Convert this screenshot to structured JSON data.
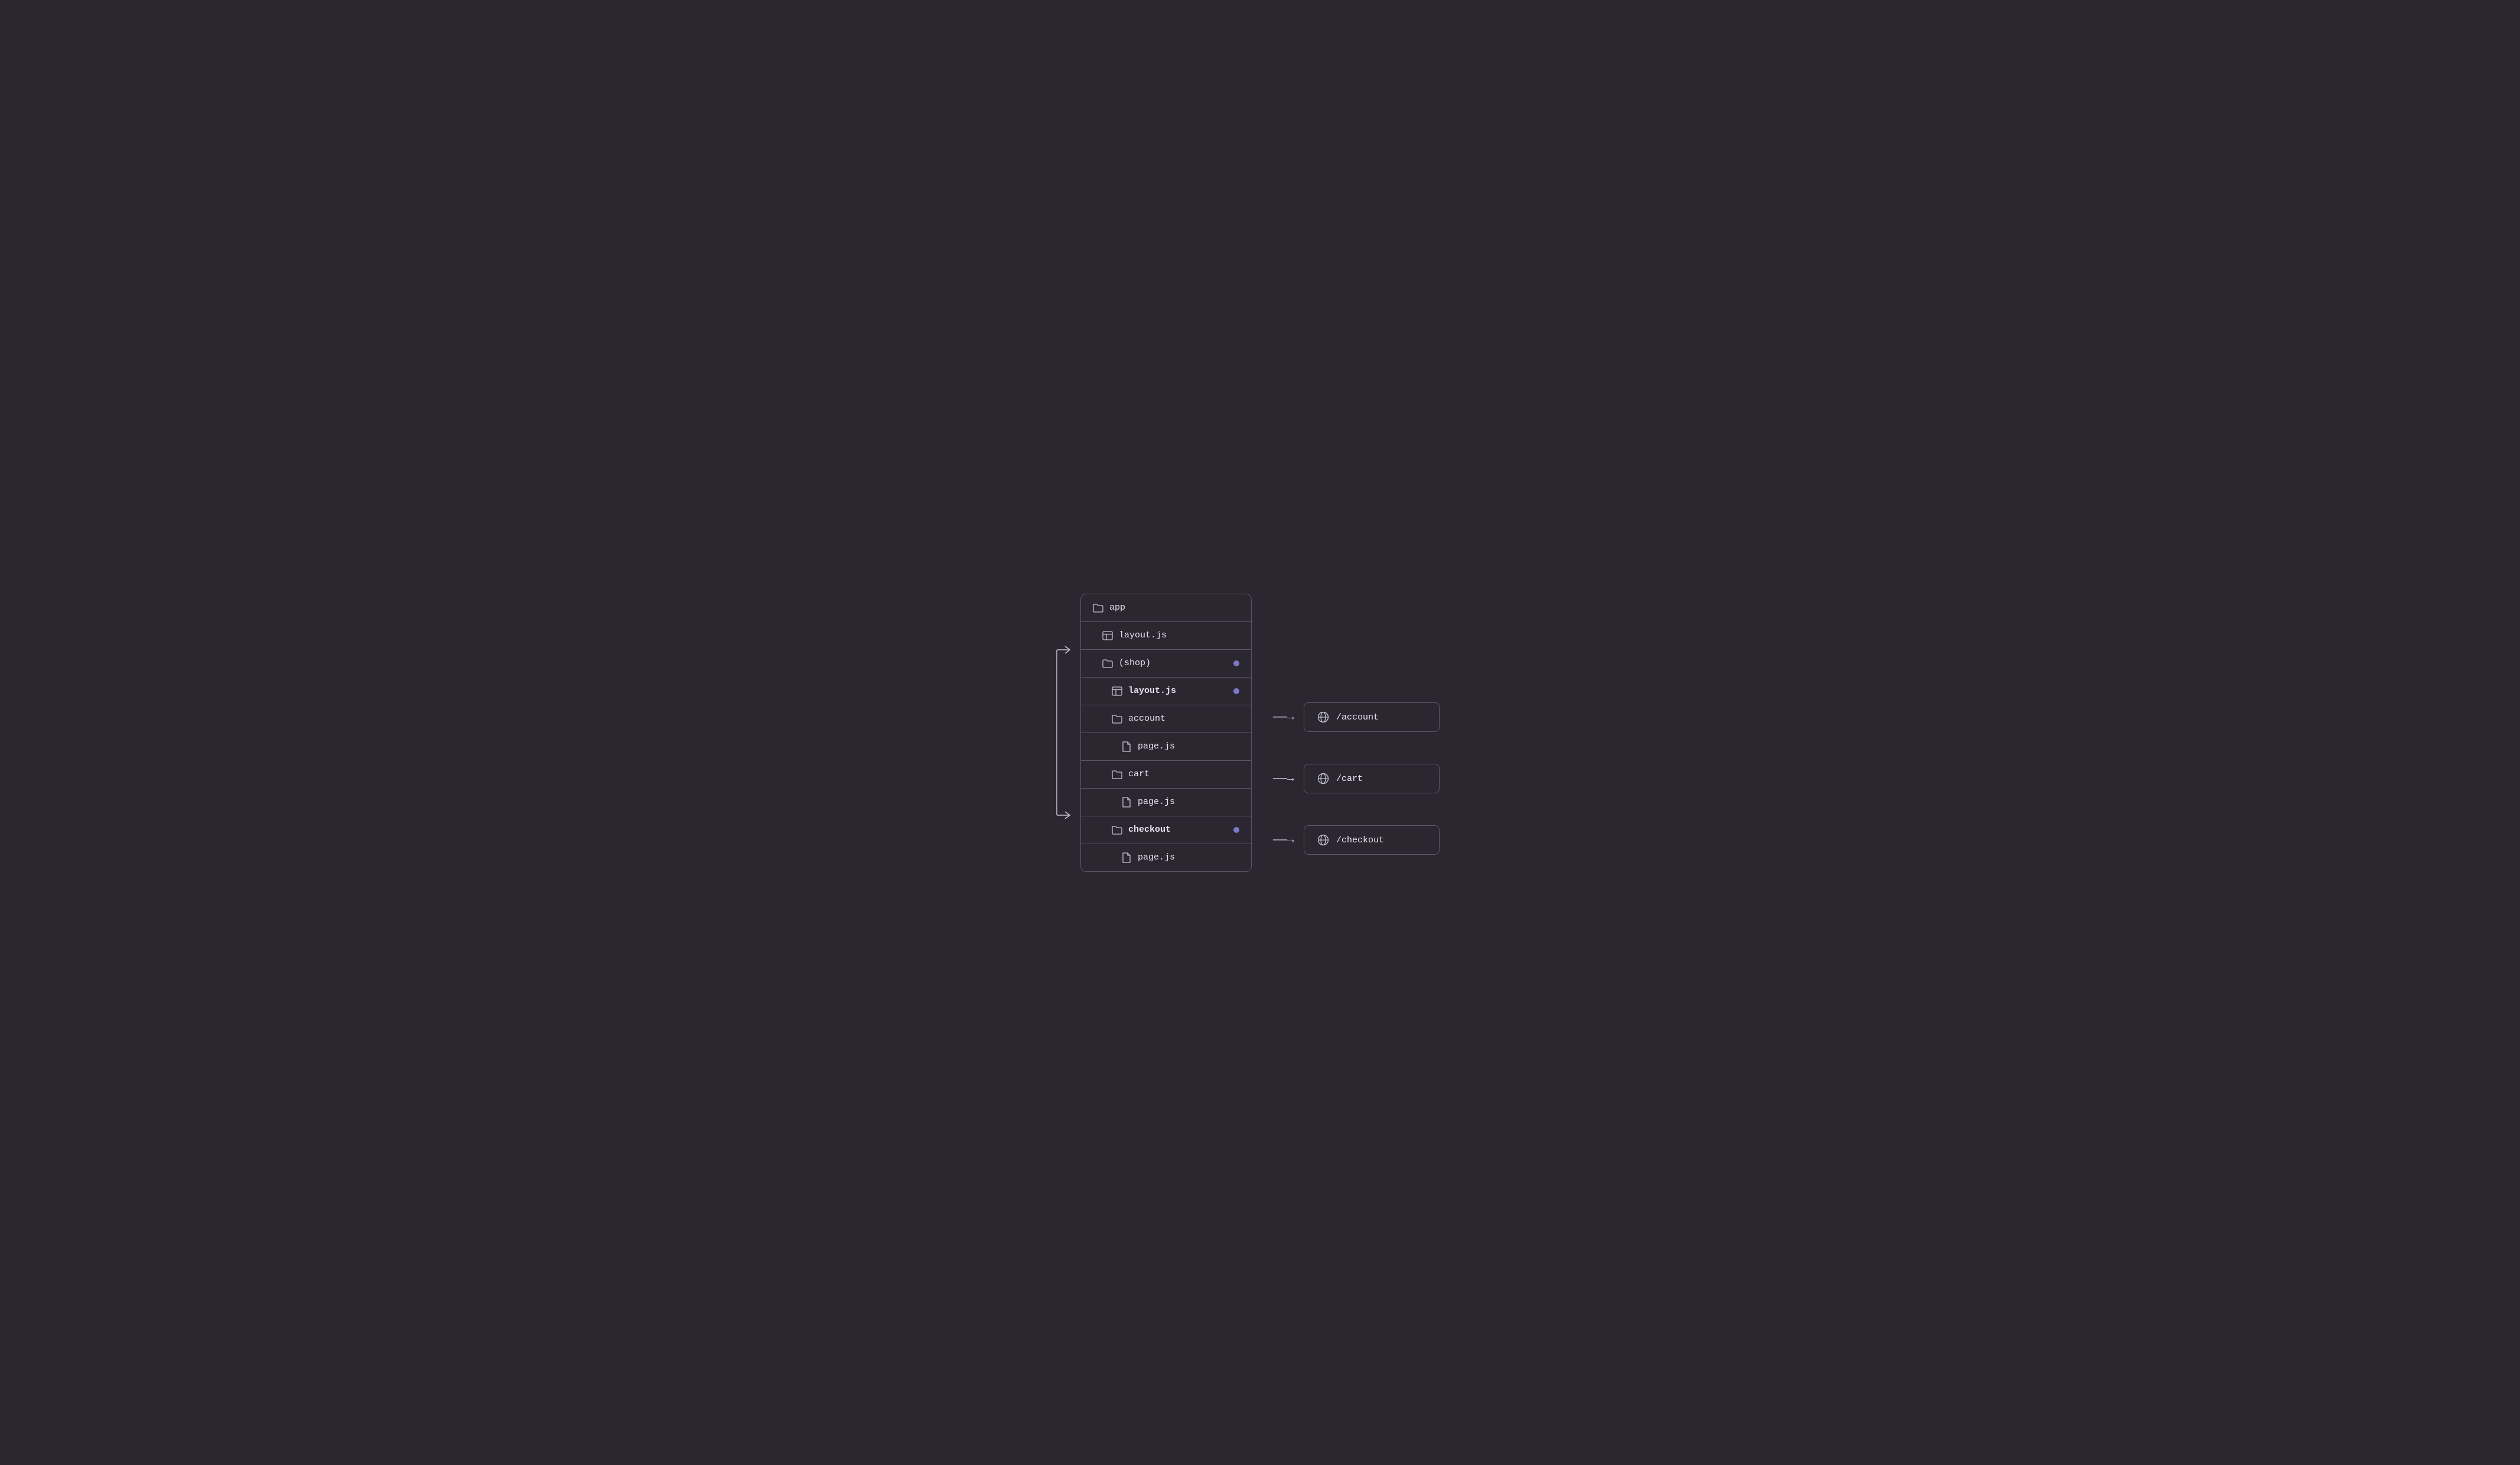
{
  "colors": {
    "bg": "#2a2730",
    "border": "#5a5567",
    "text": "#e8e4f0",
    "icon": "#c8c4d8",
    "dot": "#7b78c8"
  },
  "filetree": {
    "rows": [
      {
        "id": "app",
        "label": "app",
        "icon": "folder",
        "indent": 0,
        "bold": false,
        "dot": false
      },
      {
        "id": "layout1",
        "label": "layout.js",
        "icon": "layout",
        "indent": 1,
        "bold": false,
        "dot": false
      },
      {
        "id": "shop",
        "label": "(shop)",
        "icon": "folder",
        "indent": 1,
        "bold": false,
        "dot": true
      },
      {
        "id": "layout2",
        "label": "layout.js",
        "icon": "layout",
        "indent": 2,
        "bold": true,
        "dot": true
      },
      {
        "id": "account",
        "label": "account",
        "icon": "folder",
        "indent": 2,
        "bold": false,
        "dot": false
      },
      {
        "id": "page1",
        "label": "page.js",
        "icon": "file",
        "indent": 3,
        "bold": false,
        "dot": false
      },
      {
        "id": "cart",
        "label": "cart",
        "icon": "folder",
        "indent": 2,
        "bold": false,
        "dot": false
      },
      {
        "id": "page2",
        "label": "page.js",
        "icon": "file",
        "indent": 3,
        "bold": false,
        "dot": false
      },
      {
        "id": "checkout",
        "label": "checkout",
        "icon": "folder",
        "indent": 2,
        "bold": true,
        "dot": true
      },
      {
        "id": "page3",
        "label": "page.js",
        "icon": "file",
        "indent": 3,
        "bold": false,
        "dot": false
      }
    ]
  },
  "routes": [
    {
      "id": "account-route",
      "path": "/account",
      "row_index": 4
    },
    {
      "id": "cart-route",
      "path": "/cart",
      "row_index": 6
    },
    {
      "id": "checkout-route",
      "path": "/checkout",
      "row_index": 8
    }
  ],
  "arrows": {
    "label": "→"
  }
}
